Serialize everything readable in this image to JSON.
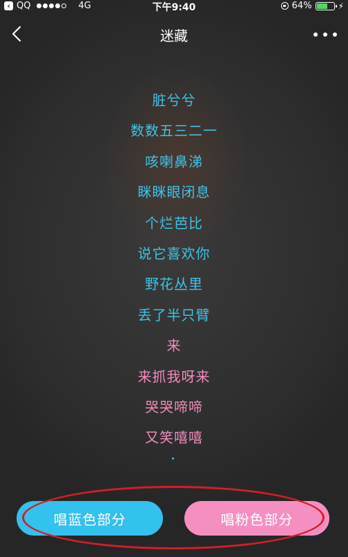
{
  "status_bar": {
    "carrier": "QQ",
    "network": "4G",
    "time": "下午9:40",
    "battery_percent": "64%",
    "battery_level": 0.64,
    "signal_filled": 4,
    "signal_total": 5
  },
  "nav": {
    "title": "迷藏"
  },
  "lyrics": [
    {
      "text": "脏兮兮",
      "color": "blue"
    },
    {
      "text": "数数五三二一",
      "color": "blue"
    },
    {
      "text": "咳喇鼻涕",
      "color": "blue"
    },
    {
      "text": "眯眯眼闭息",
      "color": "blue"
    },
    {
      "text": "个烂芭比",
      "color": "blue"
    },
    {
      "text": "说它喜欢你",
      "color": "blue"
    },
    {
      "text": "野花丛里",
      "color": "blue"
    },
    {
      "text": "丢了半只臂",
      "color": "blue"
    },
    {
      "text": "来",
      "color": "pink"
    },
    {
      "text": "来抓我呀来",
      "color": "pink"
    },
    {
      "text": "哭哭啼啼",
      "color": "pink"
    },
    {
      "text": "又笑嘻嘻",
      "color": "pink"
    }
  ],
  "buttons": {
    "sing_blue": "唱蓝色部分",
    "sing_pink": "唱粉色部分"
  },
  "colors": {
    "blue_part": "#3cc3e8",
    "pink_part": "#f08cbc",
    "annotation": "#d61d25"
  }
}
